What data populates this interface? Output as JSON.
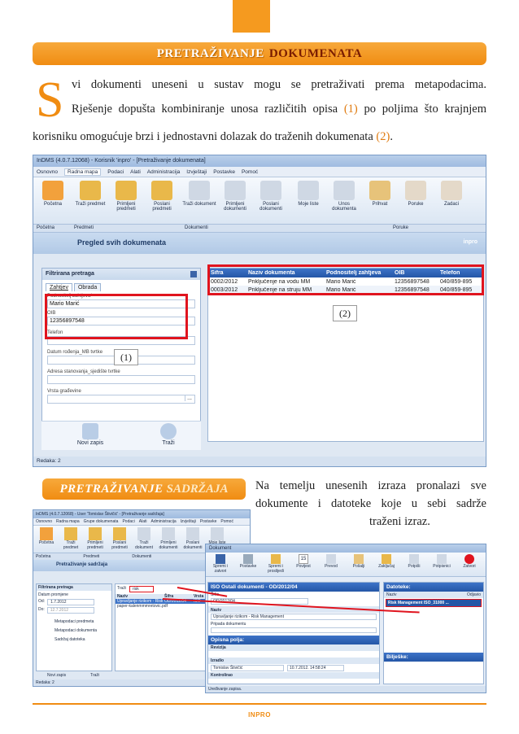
{
  "title": {
    "part1": "PRETRAŽIVANJE",
    "part2": "DOKUMENATA"
  },
  "intro": {
    "dropcap": "S",
    "line1": "vi dokumenti uneseni u sustav mogu se pretraživati prema metapodacima.",
    "line2_a": "Rješenje dopušta kombiniranje unosa različitih opisa ",
    "ref1": "(1)",
    "line2_b": " po poljima što krajnjem",
    "line3_a": "korisniku omogućuje brzi i jednostavni dolazak do traženih dokumenata ",
    "ref2": "(2)",
    "line3_b": "."
  },
  "screen1": {
    "window_title": "InDMS (4.0.7.12068) - Korisnik 'inpro' - [Pretraživanje dokumenata]",
    "menu": [
      "Osnovno",
      "Radna mapa",
      "Podaci",
      "Alati",
      "Administracija",
      "Izvještaji",
      "Postavke",
      "Pomoć"
    ],
    "ribbon": [
      "Početna",
      "Traži predmet",
      "Primljeni predmeti",
      "Poslani predmeti",
      "Traži dokument",
      "Primljeni dokumenti",
      "Poslani dokumenti",
      "Moje liste",
      "Unos dokumenta",
      "Prihvat",
      "Poruke",
      "Zadaci"
    ],
    "groups": [
      "Početna",
      "Predmeti",
      "Dokumenti",
      "Poruke"
    ],
    "header": "Pregled svih dokumenata",
    "header_right": "inpro",
    "filter_title": "Filtrirana pretraga",
    "tabs": [
      "Zahtjev",
      "Obrada"
    ],
    "fields": [
      {
        "label": "Podnositelj zahtjeva*",
        "value": "Mario Marić"
      },
      {
        "label": "OIB",
        "value": "12356897548"
      },
      {
        "label": "Telefon",
        "value": ""
      },
      {
        "label": "Datum rođenja_MB tvrtke",
        "value": ""
      },
      {
        "label": "Adresa stanovanja_sjedište tvrtke",
        "value": ""
      },
      {
        "label": "Vrsta građevine",
        "value": ""
      }
    ],
    "field_ellipsis": "...",
    "buttons": [
      "Novi zapis",
      "Traži"
    ],
    "columns": [
      "Šifra",
      "Naziv dokumenta",
      "Podnositelj zahtjeva",
      "OIB",
      "Telefon"
    ],
    "rows": [
      [
        "0002/2012",
        "Priključenje na vodu MM",
        "Mario Marić",
        "12356897548",
        "040/859-895"
      ],
      [
        "0003/2012",
        "Priključenje na struju MM",
        "Mario Marić",
        "12356897548",
        "040/859-895"
      ]
    ],
    "callout1": "(1)",
    "callout2": "(2)",
    "status": "Redaka: 2"
  },
  "section2": {
    "title_a": "PRETRAŽIVANJE",
    "title_b": "SADRŽAJA",
    "line1": "Na temelju unesenih izraza pronalazi sve",
    "line2": "dokumente i datoteke koje u sebi sadrže",
    "line3": "traženi izraz."
  },
  "screen2": {
    "window_title": "InDMS (4.0.7.12068) - User 'Tomislav Štivičić' - [Pretraživanje sadržaja]",
    "menu": [
      "Osnovno",
      "Radna mapa",
      "Grupe dokumenata",
      "Podaci",
      "Alati",
      "Administracija",
      "Izvještaji",
      "Postavke",
      "Pomoć"
    ],
    "ribbon": [
      "Početna",
      "Traži predmet",
      "Primljeni predmeti",
      "Poslani predmeti",
      "Traži dokument",
      "Primljeni dokumenti",
      "Poslani dokumenti",
      "Moje liste"
    ],
    "groups": [
      "Početna",
      "Predmeti",
      "Dokumenti"
    ],
    "header": "Pretraživanje sadržaja",
    "filter_title": "Filtrirana pretraga",
    "date_label": "Datum promjene",
    "from_label": "Od:",
    "from_value": "1.7.2012",
    "to_label": "Do:",
    "to_value": "12.7.2012",
    "checks": [
      "Metapodaci predmeta",
      "Metapodaci dokumenta",
      "Sadržaj datoteka"
    ],
    "search_label": "Traži",
    "search_value": "risk",
    "result_cols": [
      "Naziv",
      "Šifra",
      "Vrsta"
    ],
    "result_rows": [
      [
        "Upravljanje rizikom - Risk",
        "OD/2012/04",
        "ISO"
      ],
      [
        "paper-kalenmmmretovic.pdf",
        "",
        ""
      ]
    ],
    "buttons": [
      "Novi zapis",
      "Traži"
    ],
    "status": "Redaka: 2"
  },
  "screen3": {
    "window_title": "Dokument",
    "toolbar": [
      "Spremi i zatvori",
      "Postavke",
      "Spremi i proslijedi",
      "Povijest",
      "Prevod",
      "Pošalji",
      "Zaključaj",
      "Potpiši",
      "Potpisnici",
      "Zatvori"
    ],
    "calendar_number": "15",
    "doc_header": "ISO Ostali dokumenti - OD/2012/04",
    "sifra_label": "Šifra",
    "sifra_value": "OD/2012/04",
    "naziv_section": "Naziv",
    "naziv_value": "Upravljanje rizikom - Risk Management",
    "pripada_label": "Pripada dokumentu",
    "opisna_polja": "Opisna polja:",
    "revizija": "Revizija",
    "izradio_section": "Izradio",
    "izradio_value": "Tomislav Štivičić",
    "date_value": "10.7.2012. 14:58:24",
    "kontrolirao": "Kontrolirao",
    "datoteke": "Datoteke:",
    "file_cols": [
      "Naziv",
      "Odjavio"
    ],
    "file_name": "Risk Management ISO_31000 ...",
    "biljeske": "Bilješke:",
    "status": "Uređivanje zapisa."
  },
  "footer": {
    "a": "IN",
    "b": "PRO"
  },
  "colors": {
    "accent": "#f08c12",
    "highlight": "#e0141e",
    "table_header": "#2456a6"
  }
}
